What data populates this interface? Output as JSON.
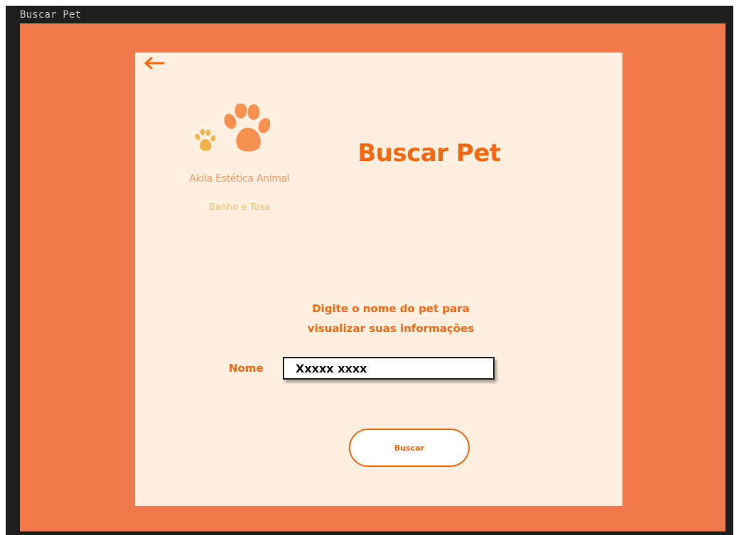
{
  "window": {
    "title": "Buscar Pet"
  },
  "colors": {
    "page_background": "#1e1e1e",
    "canvas_background": "#f07a4c",
    "card_background": "#fff0e2",
    "accent": "#f7670f",
    "paw_large": "#f7914f",
    "paw_small": "#f2b34a",
    "brand_text": "#f79a60",
    "tagline_text": "#eec06d"
  },
  "icons": {
    "back": "back-arrow-icon",
    "logo": "paw-print-icon"
  },
  "brand": {
    "name": "Akila Estética  Animal",
    "tagline": "Banho e Tosa"
  },
  "main": {
    "title": "Buscar Pet",
    "instruction_line1": "Digite o nome do pet para",
    "instruction_line2": "visualizar suas informações"
  },
  "form": {
    "name_label": "Nome",
    "name_value": "Xxxxx xxxx",
    "search_button": "Buscar"
  }
}
